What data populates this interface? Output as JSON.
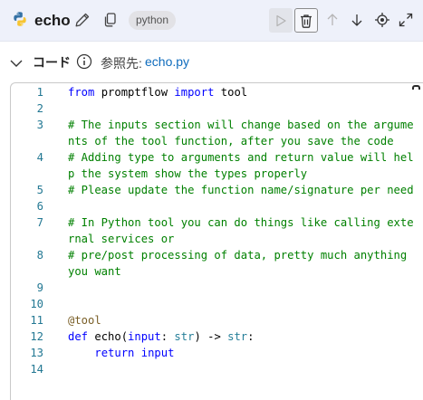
{
  "header": {
    "node_name": "echo",
    "type_badge": "python",
    "icons": {
      "logo": "python-logo-icon",
      "edit": "pencil-icon",
      "copy": "copy-icon",
      "run": "play-icon",
      "delete": "trash-icon",
      "up": "arrow-up-icon",
      "down": "arrow-down-icon",
      "locate": "target-icon",
      "expand": "expand-icon"
    }
  },
  "code_section": {
    "title": "コード",
    "ref_label": "参照先:",
    "ref_file": "echo.py",
    "icons": {
      "collapse": "chevron-down-icon",
      "info": "info-icon"
    }
  },
  "editor": {
    "lines": [
      {
        "num": "1",
        "parts": [
          {
            "t": "from",
            "c": "kw"
          },
          {
            "t": " promptflow ",
            "c": ""
          },
          {
            "t": "import",
            "c": "kw"
          },
          {
            "t": " tool",
            "c": ""
          }
        ]
      },
      {
        "num": "2",
        "parts": []
      },
      {
        "num": "3",
        "parts": [
          {
            "t": "# The inputs section will change based on the arguments of the tool function, after you save the code",
            "c": "comment"
          }
        ]
      },
      {
        "num": "4",
        "parts": [
          {
            "t": "# Adding type to arguments and return value will help the system show the types properly",
            "c": "comment"
          }
        ]
      },
      {
        "num": "5",
        "parts": [
          {
            "t": "# Please update the function name/signature per need",
            "c": "comment"
          }
        ]
      },
      {
        "num": "6",
        "parts": []
      },
      {
        "num": "7",
        "parts": [
          {
            "t": "# In Python tool you can do things like calling external services or",
            "c": "comment"
          }
        ]
      },
      {
        "num": "8",
        "parts": [
          {
            "t": "# pre/post processing of data, pretty much anything you want",
            "c": "comment"
          }
        ]
      },
      {
        "num": "9",
        "parts": []
      },
      {
        "num": "10",
        "parts": []
      },
      {
        "num": "11",
        "parts": [
          {
            "t": "@tool",
            "c": "dec"
          }
        ]
      },
      {
        "num": "12",
        "parts": [
          {
            "t": "def",
            "c": "kw"
          },
          {
            "t": " echo(",
            "c": ""
          },
          {
            "t": "input",
            "c": "kw"
          },
          {
            "t": ": ",
            "c": ""
          },
          {
            "t": "str",
            "c": "typ"
          },
          {
            "t": ") -> ",
            "c": ""
          },
          {
            "t": "str",
            "c": "typ"
          },
          {
            "t": ":",
            "c": ""
          }
        ]
      },
      {
        "num": "13",
        "parts": [
          {
            "t": "    ",
            "c": ""
          },
          {
            "t": "return",
            "c": "kw"
          },
          {
            "t": " ",
            "c": ""
          },
          {
            "t": "input",
            "c": "kw"
          }
        ]
      },
      {
        "num": "14",
        "parts": []
      }
    ]
  }
}
